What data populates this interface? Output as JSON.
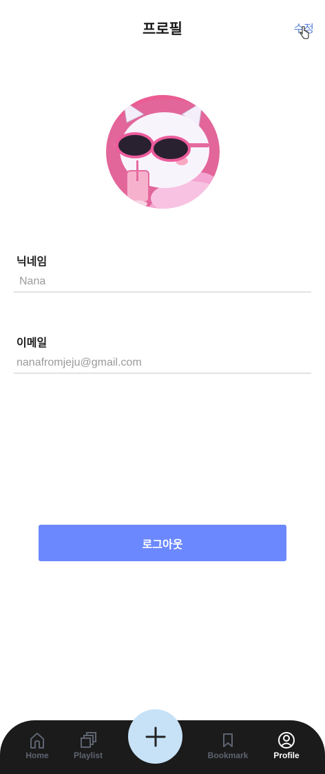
{
  "header": {
    "title": "프로필",
    "edit_label": "수정"
  },
  "profile": {
    "avatar_icon": "cat-with-sunglasses-avatar",
    "nickname_label": "닉네임",
    "nickname_value": "Nana",
    "email_label": "이메일",
    "email_value": "nanafromjeju@gmail.com"
  },
  "actions": {
    "logout_label": "로그아웃"
  },
  "tabbar": {
    "items": [
      {
        "label": "Home",
        "icon": "home-icon",
        "active": false
      },
      {
        "label": "Playlist",
        "icon": "playlist-icon",
        "active": false
      },
      {
        "label": "Bookmark",
        "icon": "bookmark-icon",
        "active": false
      },
      {
        "label": "Profile",
        "icon": "profile-icon",
        "active": true
      }
    ],
    "fab_icon": "plus-icon"
  },
  "colors": {
    "accent": "#6b88fe",
    "link": "#5f86d8",
    "tabbar_bg": "#1b1b1b",
    "fab_bg": "#c7e2f7"
  }
}
